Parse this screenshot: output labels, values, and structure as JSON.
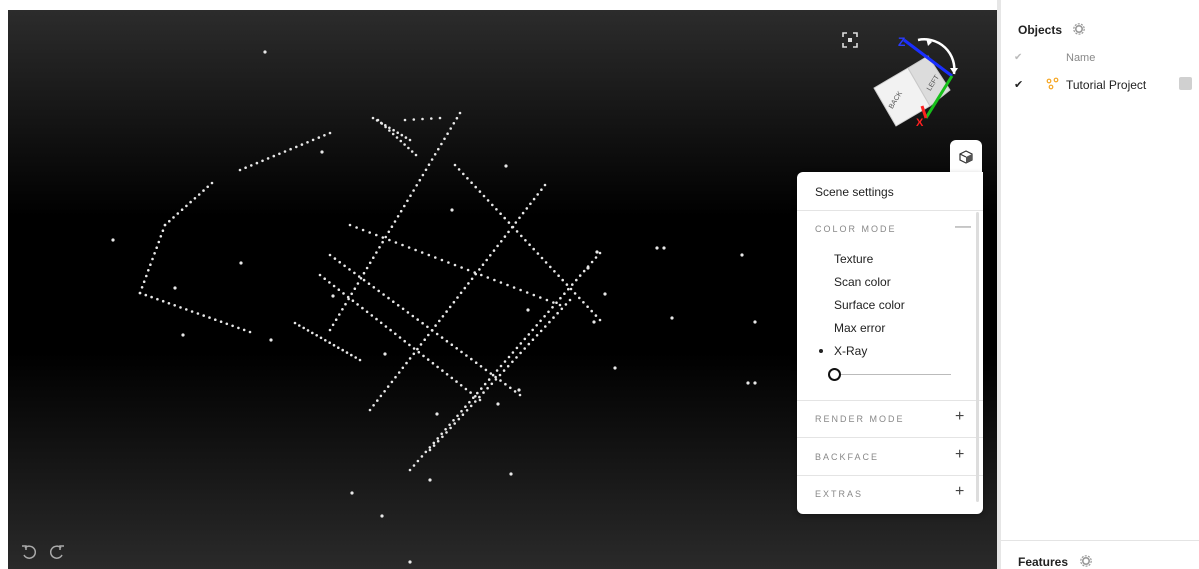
{
  "viewport": {
    "cube_labels": {
      "back": "BACK",
      "left": "LEFT",
      "z_axis": "Z",
      "x_axis": "X"
    }
  },
  "scene_settings": {
    "title": "Scene settings",
    "color_mode": {
      "header": "COLOR MODE",
      "control": "—",
      "options": [
        "Texture",
        "Scan color",
        "Surface color",
        "Max error",
        "X-Ray"
      ],
      "selected": "X-Ray",
      "xray_level": 0.0
    },
    "sections": [
      {
        "label": "RENDER MODE",
        "control": "+"
      },
      {
        "label": "BACKFACE",
        "control": "+"
      },
      {
        "label": "EXTRAS",
        "control": "+"
      }
    ]
  },
  "objects_panel": {
    "title": "Objects",
    "columns": {
      "check": "✔",
      "name": "Name"
    },
    "rows": [
      {
        "check": "✔",
        "name": "Tutorial Project",
        "icon": "point-cloud-icon",
        "icon_color": "#f5a623"
      }
    ]
  },
  "features_panel": {
    "title": "Features"
  }
}
